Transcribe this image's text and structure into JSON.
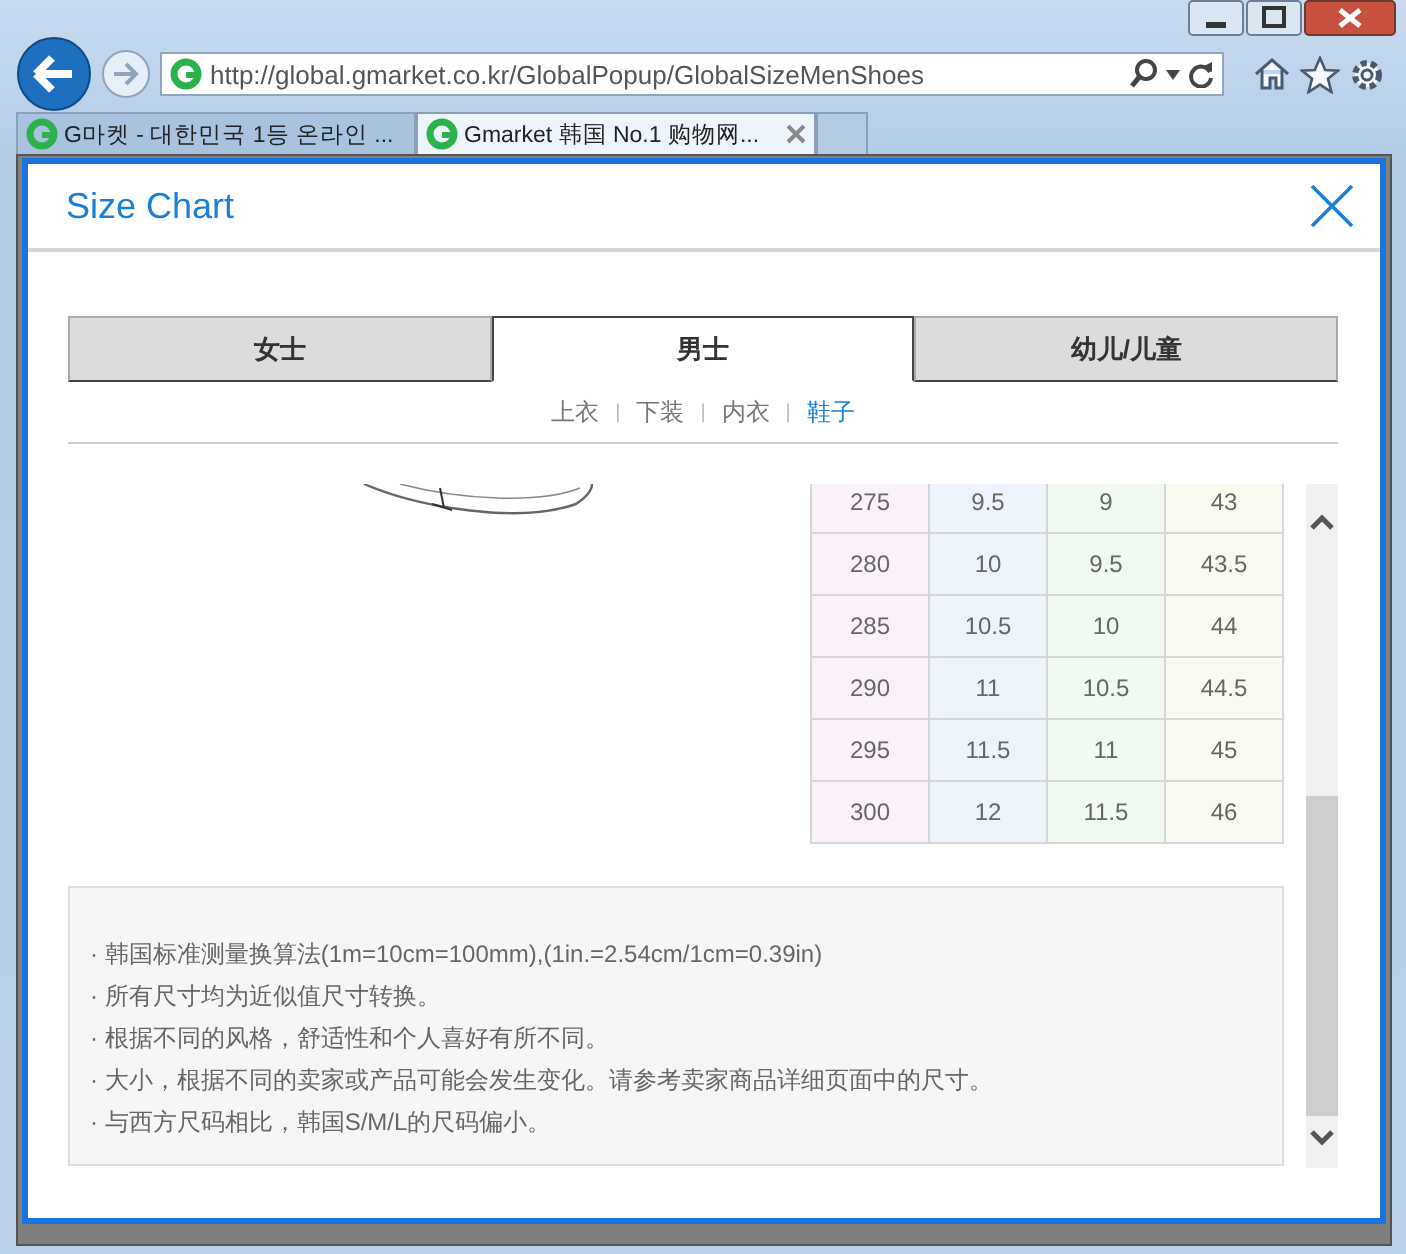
{
  "browser": {
    "address": "http://global.gmarket.co.kr/GlobalPopup/GlobalSizeMenShoes",
    "tabs": [
      {
        "label": "G마켓 - 대한민국 1등 온라인 ...",
        "selected": false,
        "closable": false
      },
      {
        "label": "Gmarket 韩国 No.1 购物网...",
        "selected": true,
        "closable": true
      }
    ]
  },
  "popup": {
    "title": "Size Chart"
  },
  "tabs": [
    {
      "label": "女士",
      "selected": false
    },
    {
      "label": "男士",
      "selected": true
    },
    {
      "label": "幼儿/儿童",
      "selected": false
    }
  ],
  "subtab_separators": [
    "|",
    "|",
    "|"
  ],
  "subtabs": [
    {
      "label": "上衣",
      "selected": false
    },
    {
      "label": "下装",
      "selected": false
    },
    {
      "label": "内衣",
      "selected": false
    },
    {
      "label": "鞋子",
      "selected": true
    }
  ],
  "size_table": {
    "rows": [
      [
        "275",
        "9.5",
        "9",
        "43"
      ],
      [
        "280",
        "10",
        "9.5",
        "43.5"
      ],
      [
        "285",
        "10.5",
        "10",
        "44"
      ],
      [
        "290",
        "11",
        "10.5",
        "44.5"
      ],
      [
        "295",
        "11.5",
        "11",
        "45"
      ],
      [
        "300",
        "12",
        "11.5",
        "46"
      ]
    ]
  },
  "notes": [
    "· 韩国标准测量换算法(1m=10cm=100mm),(1in.=2.54cm/1cm=0.39in)",
    "· 所有尺寸均为近似值尺寸转换。",
    "· 根据不同的风格，舒适性和个人喜好有所不同。",
    "· 大小，根据不同的卖家或产品可能会发生变化。请参考卖家商品详细页面中的尺寸。",
    "· 与西方尺码相比，韩国S/M/L的尺码偏小。"
  ]
}
